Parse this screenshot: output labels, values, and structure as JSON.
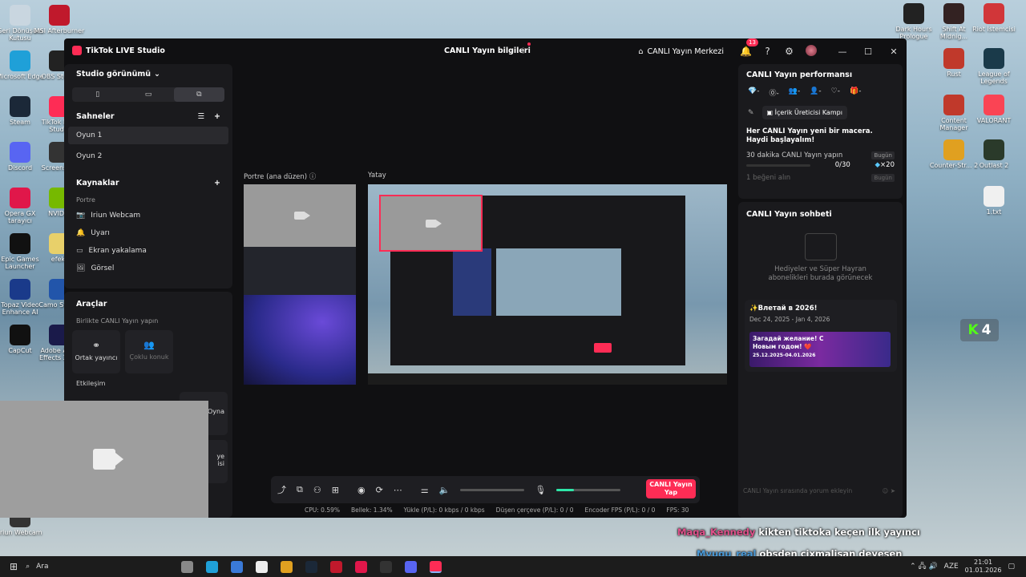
{
  "desktop_icons_left": [
    {
      "label": "Geri Dönüşüm Kutusu",
      "color": "#c9d6e0"
    },
    {
      "label": "MSI Afterburner",
      "color": "#c0192c"
    },
    {
      "label": "Microsoft Edge",
      "color": "#1fa0d8"
    },
    {
      "label": "OBS Studio",
      "color": "#222"
    },
    {
      "label": "Steam",
      "color": "#1b2838"
    },
    {
      "label": "TikTok LIVE Studio",
      "color": "#fe2c55"
    },
    {
      "label": "Discord",
      "color": "#5865f2"
    },
    {
      "label": "Screenshot",
      "color": "#333"
    },
    {
      "label": "Opera GX tarayıcı",
      "color": "#e0174a"
    },
    {
      "label": "NVIDIA",
      "color": "#76b900"
    },
    {
      "label": "Epic Games Launcher",
      "color": "#111"
    },
    {
      "label": "efekt",
      "color": "#e8d06a"
    },
    {
      "label": "Topaz Video Enhance AI",
      "color": "#1a3a8a"
    },
    {
      "label": "Camo Studio",
      "color": "#2255aa"
    },
    {
      "label": "CapCut",
      "color": "#111"
    },
    {
      "label": "Adobe After Effects 2020",
      "color": "#1a1a4a"
    },
    {
      "label": "Iriun Webcam",
      "color": "#333"
    }
  ],
  "desktop_icons_right": [
    {
      "label": "Dark Hours Prologue",
      "color": "#222"
    },
    {
      "label": "Shift At Midnig...",
      "color": "#332222"
    },
    {
      "label": "Riot İstemcisi",
      "color": "#d13639"
    },
    {
      "label": "Rust",
      "color": "#c0392b"
    },
    {
      "label": "League of Legends",
      "color": "#1a3a4a"
    },
    {
      "label": "Content Manager",
      "color": "#c0392b"
    },
    {
      "label": "VALORANT",
      "color": "#fa4454"
    },
    {
      "label": "Counter-Str... 2",
      "color": "#e0a020"
    },
    {
      "label": "Outlast 2",
      "color": "#2a3a2a"
    },
    {
      "label": "1.txt",
      "color": "#f0f0f0"
    }
  ],
  "window": {
    "app_title": "TikTok LIVE Studio",
    "center_title": "CANLI Yayın bilgileri",
    "merkez_label": "CANLI Yayın Merkezi",
    "notif_count": "13",
    "ctl_min": "—",
    "ctl_max": "☐",
    "ctl_close": "✕"
  },
  "left": {
    "studio_view": "Studio görünümü",
    "scenes_title": "Sahneler",
    "scenes": [
      "Oyun 1",
      "Oyun 2"
    ],
    "sources_title": "Kaynaklar",
    "sources_group": "Portre",
    "sources": [
      {
        "label": "Iriun Webcam",
        "icon": "📷"
      },
      {
        "label": "Uyarı",
        "icon": "🔔"
      },
      {
        "label": "Ekran yakalama",
        "icon": "▭"
      },
      {
        "label": "Görsel",
        "icon": "🖼"
      }
    ],
    "tools_title": "Araçlar",
    "tools_sub": "Birlikte CANLI Yayın yapın",
    "tool_cohost": "Ortak yayıncı",
    "tool_multi": "Çoklu konuk",
    "interaction": "Etkileşim",
    "tool_partial1": "Oyna",
    "tool_partial2": "ye\nisi"
  },
  "center": {
    "portrait_label": "Portre (ana düzen)",
    "landscape_label": "Yatay",
    "go_live": "CANLI Yayın Yap",
    "stats": [
      "CPU: 0.59%",
      "Bellek: 1.34%",
      "Yükle (P/L): 0 kbps / 0 kbps",
      "Düşen çerçeve (P/L): 0 / 0",
      "Encoder FPS (P/L): 0 / 0",
      "FPS: 30"
    ]
  },
  "right": {
    "perf_title": "CANLI Yayın performansı",
    "perf_values": [
      "-",
      "-",
      "-",
      "-",
      "-",
      "-"
    ],
    "campaign": "İçerik Üreticisi Kampı",
    "adventure": "Her CANLI Yayın yeni bir macera. Haydi başlayalım!",
    "task1": "30 dakika CANLI Yayın yapın",
    "task1_badge": "Bugün",
    "task1_progress": "0/30",
    "task1_reward": "×20",
    "task2": "1 beğeni alın",
    "task2_badge": "Bugün",
    "chat_title": "CANLI Yayın sohbeti",
    "chat_empty": "Hediyeler ve Süper Hayran abonelikleri burada görünecek",
    "promo_title": "✨Влетай в 2026!",
    "promo_dates": "Dec 24, 2025 - Jan 4, 2026",
    "promo_img_text": "Загадай желание! С Новым годом! ❤️",
    "promo_img_dates": "25.12.2025-04.01.2026",
    "chat_placeholder": "CANLI Yayın sırasında yorum ekleyin"
  },
  "chat_overlay": [
    {
      "user": "Maqa_Kennedy",
      "msg": "kikten tiktoka keçen ilk yayıncı",
      "color": "#e0508a"
    },
    {
      "user": "Myuqu_real",
      "msg": "obsden cixmalisan deyesen",
      "color": "#4a9ad8"
    }
  ],
  "kick_widget": {
    "count": "4",
    "color": "#53fc18"
  },
  "taskbar": {
    "search": "Ara",
    "lang": "AZE",
    "time": "21:01",
    "date": "01.01.2026",
    "apps": [
      {
        "name": "task-view",
        "color": "#888"
      },
      {
        "name": "edge",
        "color": "#1fa0d8"
      },
      {
        "name": "store",
        "color": "#3a7ad8"
      },
      {
        "name": "capcut",
        "color": "#eee"
      },
      {
        "name": "chrome",
        "color": "#e0a020"
      },
      {
        "name": "steam",
        "color": "#1b2838"
      },
      {
        "name": "msi",
        "color": "#c0192c"
      },
      {
        "name": "opera",
        "color": "#e0174a"
      },
      {
        "name": "obs",
        "color": "#333"
      },
      {
        "name": "discord",
        "color": "#5865f2"
      },
      {
        "name": "tiktok",
        "color": "#fe2c55"
      }
    ]
  }
}
